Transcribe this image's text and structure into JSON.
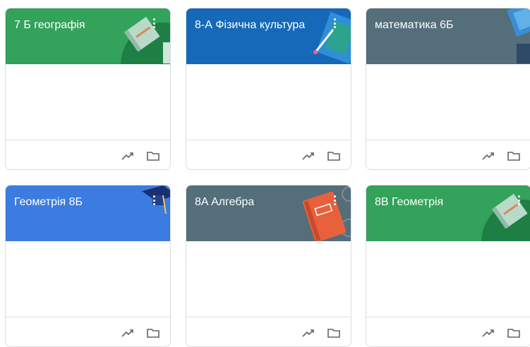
{
  "courses": [
    {
      "title": "7 Б географія",
      "theme": "#33a25a",
      "icons": [
        "more-vert-icon",
        "trending-up-icon",
        "folder-icon"
      ]
    },
    {
      "title": "8-А Фізична культура",
      "theme": "#1569b8",
      "icons": [
        "more-vert-icon",
        "trending-up-icon",
        "folder-icon"
      ]
    },
    {
      "title": "математика 6Б",
      "theme": "#546e7a",
      "icons": [
        "more-vert-icon",
        "trending-up-icon",
        "folder-icon"
      ]
    },
    {
      "title": "Геометрія 8Б",
      "theme": "#3c7ce0",
      "icons": [
        "more-vert-icon",
        "trending-up-icon",
        "folder-icon"
      ]
    },
    {
      "title": "8A Алгебра",
      "theme": "#546e7a",
      "icons": [
        "more-vert-icon",
        "trending-up-icon",
        "folder-icon"
      ]
    },
    {
      "title": "8B Геометрія",
      "theme": "#33a25a",
      "icons": [
        "more-vert-icon",
        "trending-up-icon",
        "folder-icon"
      ]
    }
  ]
}
